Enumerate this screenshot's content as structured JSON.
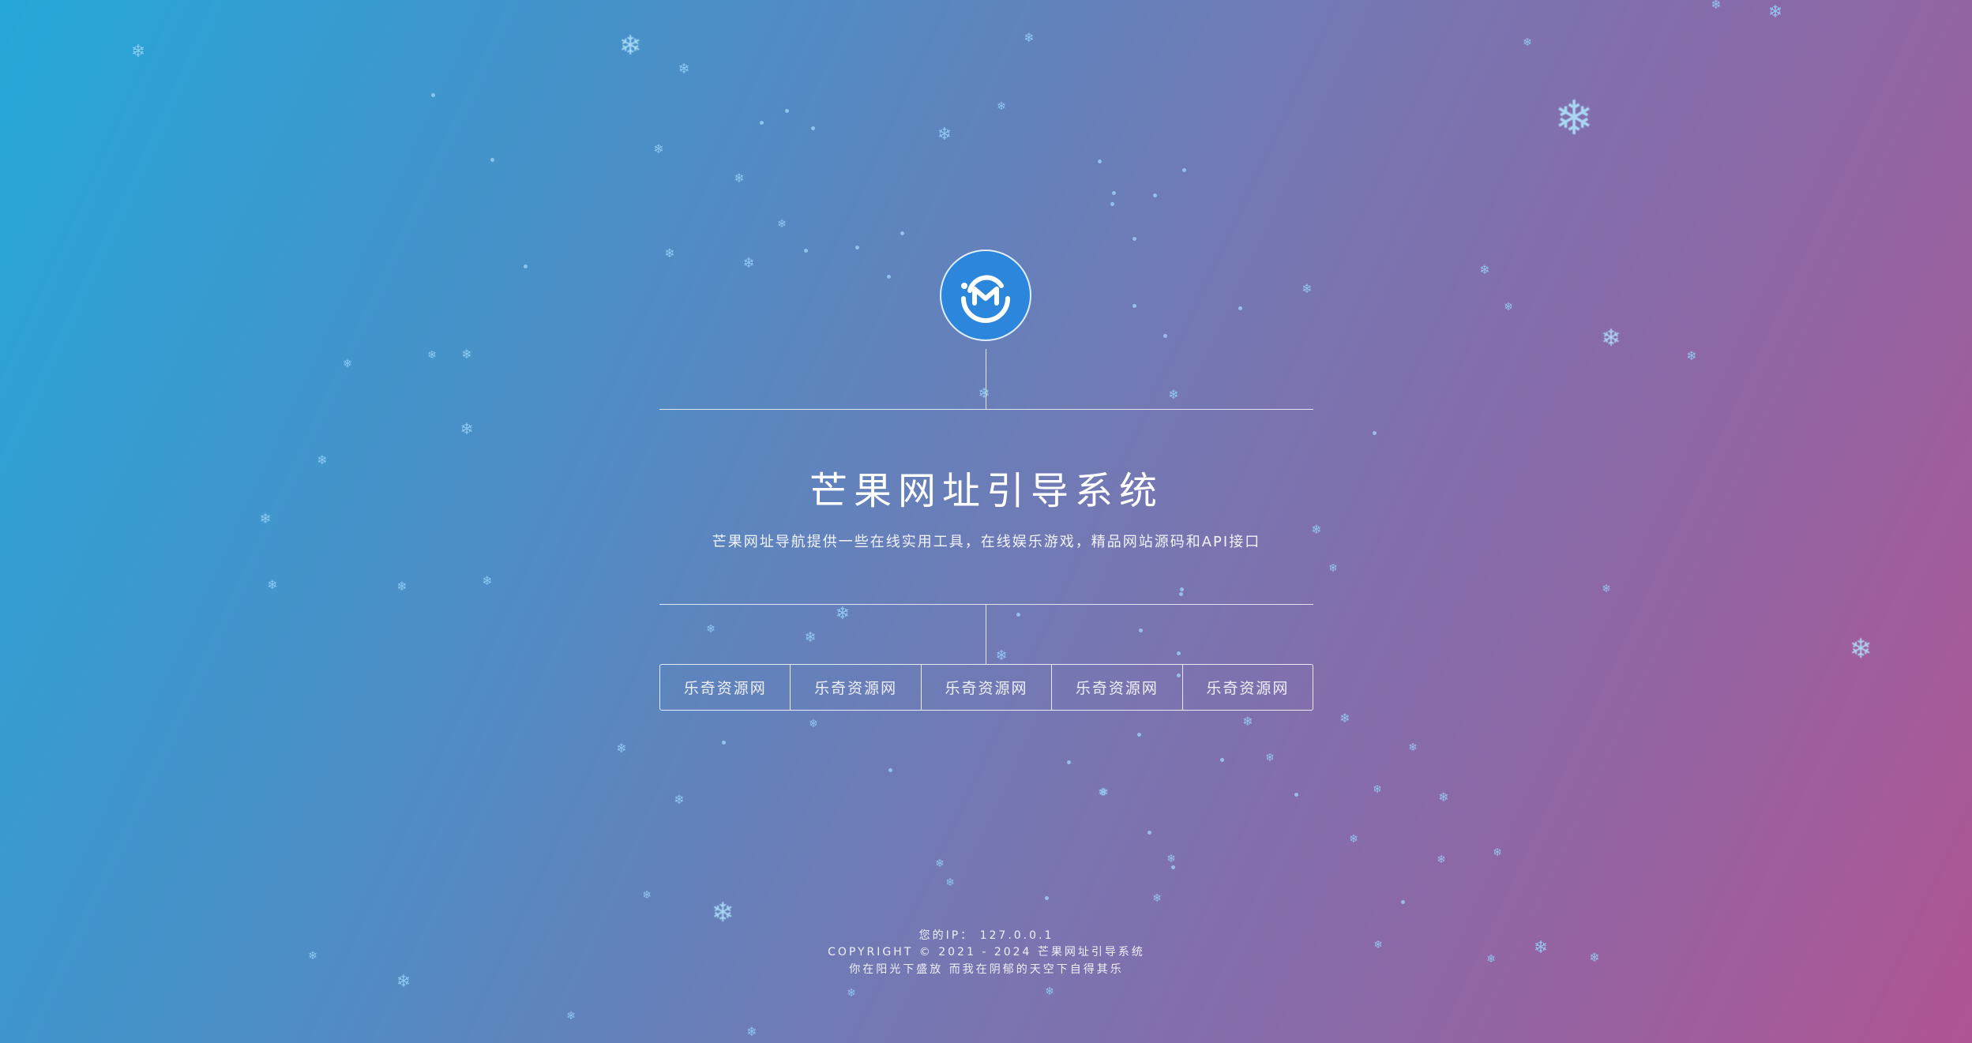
{
  "page": {
    "title": "芒果网址引导系统",
    "subtitle": "芒果网址导航提供一些在线实用工具，在线娱乐游戏，精品网站源码和API接口"
  },
  "logo": {
    "icon": "smiley-m-logo-icon",
    "color": "#2b86dc"
  },
  "nav": {
    "items": [
      {
        "label": "乐奇资源网"
      },
      {
        "label": "乐奇资源网"
      },
      {
        "label": "乐奇资源网"
      },
      {
        "label": "乐奇资源网"
      },
      {
        "label": "乐奇资源网"
      }
    ]
  },
  "footer": {
    "ip_line": "您的IP： 127.0.0.1",
    "copyright": "COPYRIGHT © 2021 - 2024 芒果网址引导系统",
    "motto": "你在阳光下盛放 而我在阴郁的天空下自得其乐"
  },
  "theme": {
    "gradient_start": "#25a7d9",
    "gradient_end": "#b05593",
    "snow_color": "#96d2fa"
  }
}
